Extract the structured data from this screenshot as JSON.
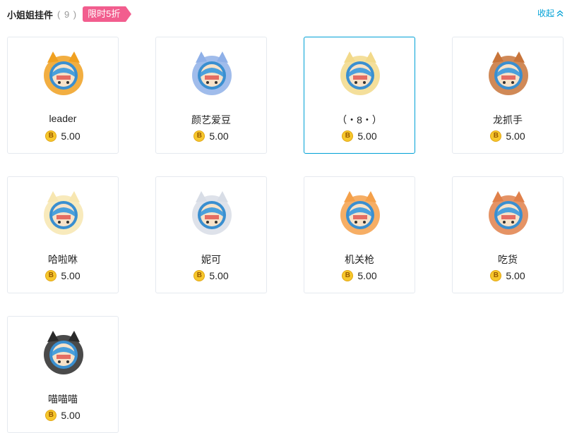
{
  "header": {
    "title": "小姐姐挂件",
    "count": "( 9 )",
    "promo": "限时5折",
    "collapse_label": "收起"
  },
  "currency_symbol": "B",
  "selected_index": 2,
  "items": [
    {
      "name": "leader",
      "price": "5.00",
      "icon": "monkey-ears-pendant-icon",
      "accent": "#f0a020"
    },
    {
      "name": "颜艺爱豆",
      "price": "5.00",
      "icon": "bunny-ears-pendant-icon",
      "accent": "#8fb0e8"
    },
    {
      "name": "（・8・）",
      "price": "5.00",
      "icon": "sheep-bell-pendant-icon",
      "accent": "#f2d98a"
    },
    {
      "name": "龙抓手",
      "price": "5.00",
      "icon": "fox-ears-pendant-icon",
      "accent": "#c8743a"
    },
    {
      "name": "哈啦咻",
      "price": "5.00",
      "icon": "cat-hood-pendant-icon",
      "accent": "#f7e6b0"
    },
    {
      "name": "妮可",
      "price": "5.00",
      "icon": "panda-pendant-icon",
      "accent": "#d8dde6"
    },
    {
      "name": "机关枪",
      "price": "5.00",
      "icon": "bow-bear-pendant-icon",
      "accent": "#f4a04a"
    },
    {
      "name": "吃货",
      "price": "5.00",
      "icon": "maid-pendant-icon",
      "accent": "#e0804a"
    },
    {
      "name": "喵喵喵",
      "price": "5.00",
      "icon": "black-cat-pendant-icon",
      "accent": "#2a2a2a"
    }
  ]
}
